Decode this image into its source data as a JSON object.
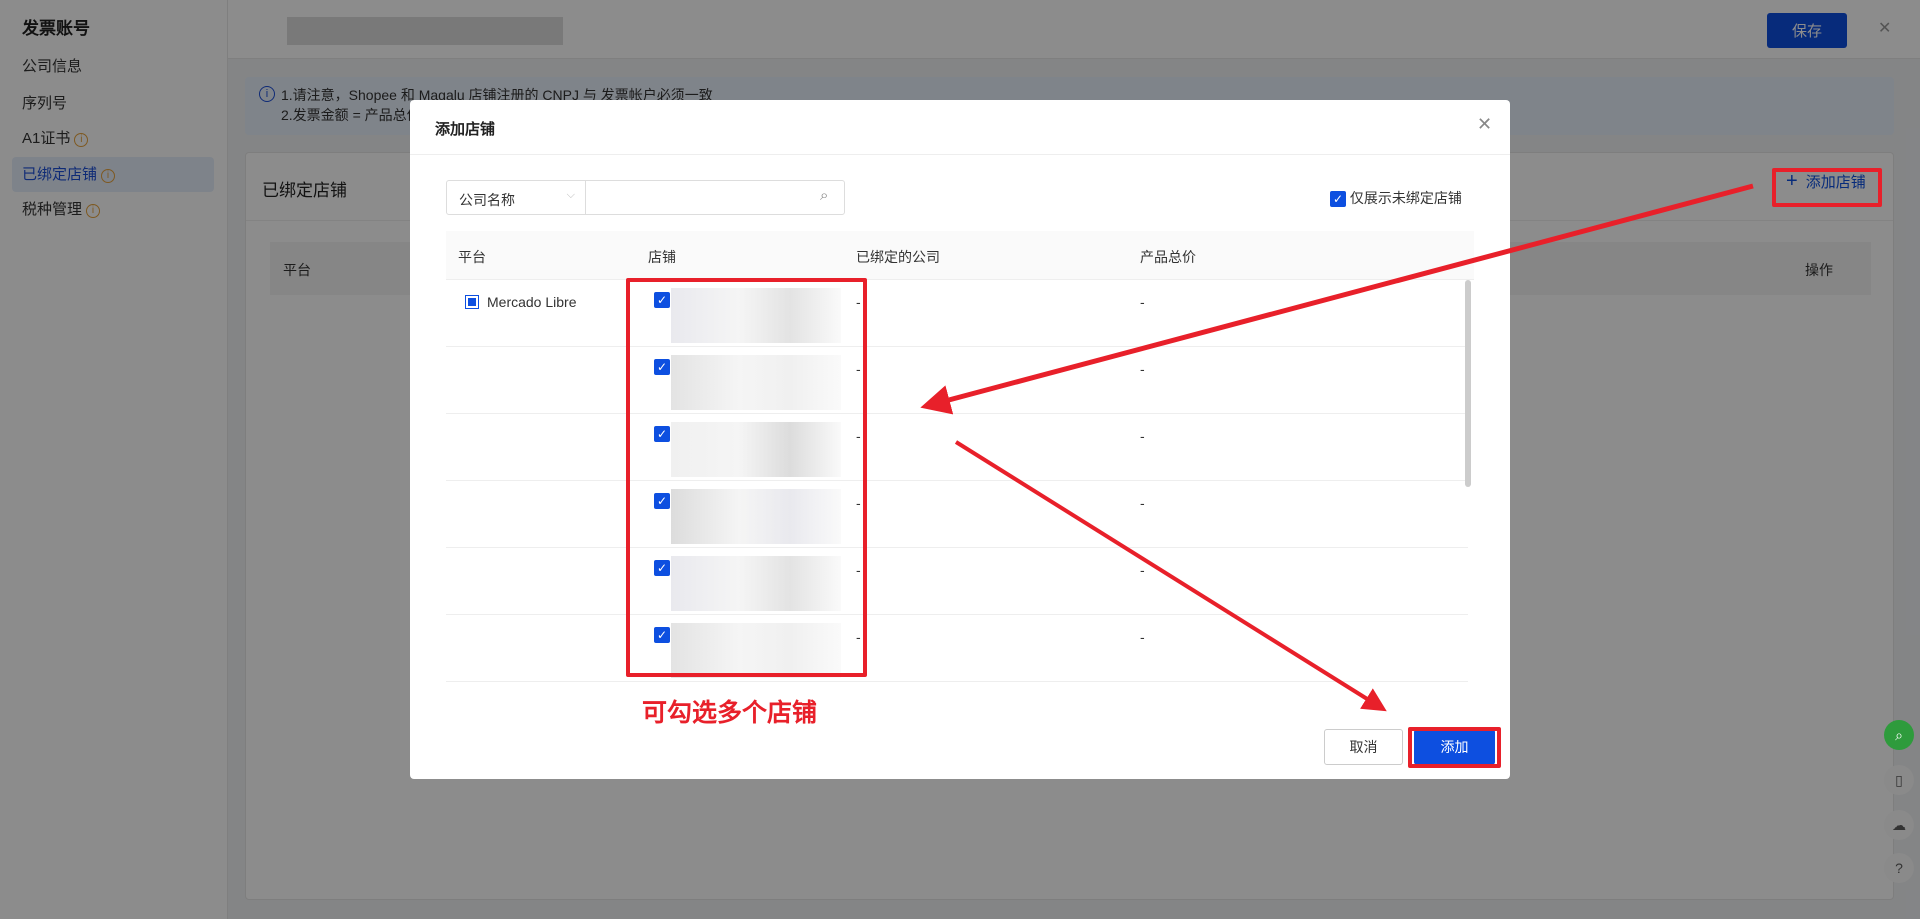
{
  "sidebar": {
    "title": "发票账号",
    "items": [
      {
        "label": "公司信息"
      },
      {
        "label": "序列号"
      },
      {
        "label": "A1证书",
        "info": true
      },
      {
        "label": "已绑定店铺",
        "info": true,
        "active": true
      },
      {
        "label": "税种管理",
        "info": true
      }
    ]
  },
  "header": {
    "save_label": "保存",
    "close_icon": "✕"
  },
  "notice": {
    "line1": "1.请注意，Shopee 和 Magalu 店铺注册的 CNPJ 与 发票帐户必须一致",
    "line2": "2.发票金额 = 产品总价"
  },
  "card": {
    "title": "已绑定店铺",
    "add_label": "添加店铺",
    "columns": [
      "平台",
      "操作"
    ]
  },
  "modal": {
    "title": "添加店铺",
    "search_field": "公司名称",
    "search_value": "",
    "only_unbound_label": "仅展示未绑定店铺",
    "columns": [
      "平台",
      "店铺",
      "已绑定的公司",
      "产品总价"
    ],
    "platform": "Mercado Libre",
    "rows": [
      {
        "company": "-",
        "price": "-"
      },
      {
        "company": "-",
        "price": "-"
      },
      {
        "company": "-",
        "price": "-"
      },
      {
        "company": "-",
        "price": "-"
      },
      {
        "company": "-",
        "price": "-"
      },
      {
        "company": "-",
        "price": "-"
      }
    ],
    "cancel_label": "取消",
    "confirm_label": "添加"
  },
  "annotation": {
    "text": "可勾选多个店铺",
    "color": "#e8202a"
  },
  "colors": {
    "primary": "#0d4fe0",
    "annotation": "#e8202a"
  }
}
